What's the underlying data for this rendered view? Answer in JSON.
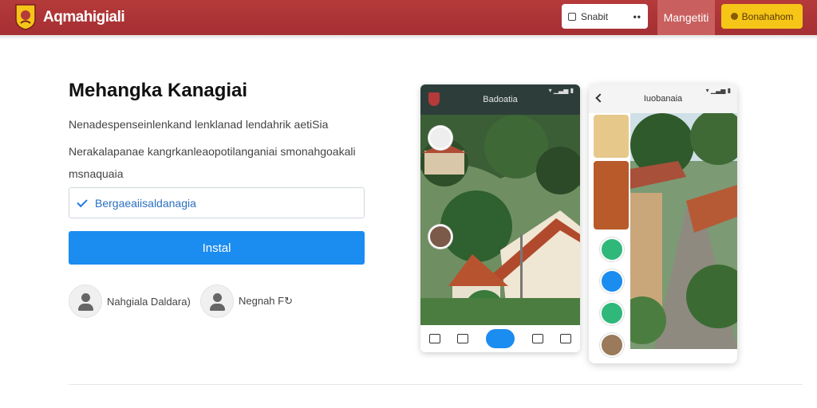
{
  "header": {
    "brand": "Aqmahigiali",
    "search_label": "Snabit",
    "nav_tab": "Mangetiti",
    "cta_label": "Bonahahom",
    "colors": {
      "bar": "#b53a3a",
      "cta": "#f5c518"
    }
  },
  "main": {
    "title": "Mehangka Kanagiai",
    "desc1": "Nenadespenseinlenkand lenklanad lendahrik aetiSia",
    "desc2": "Nerakalapanae kangrkanleaopotilanganiai smonahgoakali",
    "desc3": "msnaquaia",
    "input_value": "Bergaeaiisaldanagia",
    "install_label": "Instal",
    "contacts": [
      {
        "name": "Nahgiala Daldara)"
      },
      {
        "name": "Negnah F↻"
      }
    ],
    "accent": "#1b8cf0"
  },
  "phone1": {
    "title": "Badoatia",
    "status": "▾ ▁▃▅ ▮"
  },
  "phone2": {
    "title": "Iuobanaia",
    "status": "▾ ▁▃▅ ▮"
  }
}
